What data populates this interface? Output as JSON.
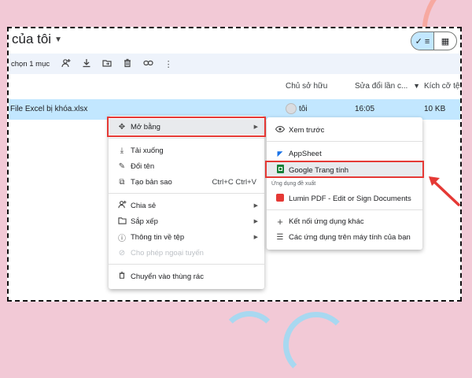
{
  "header": {
    "title": "của tôi",
    "view_list_label": "✓ ≡",
    "view_grid_label": "▦"
  },
  "toolbar": {
    "selection_text": "chọn 1 mục"
  },
  "columns": {
    "owner": "Chủ sở hữu",
    "modified": "Sửa đổi lần c...",
    "size": "Kích cỡ tệp"
  },
  "file": {
    "name": "File Excel bị khóa.xlsx",
    "owner": "tôi",
    "modified": "16:05",
    "size": "10 KB"
  },
  "context_menu": {
    "items": [
      {
        "label": "Mở bằng",
        "icon": "move-icon",
        "has_submenu": true
      },
      {
        "label": "Tải xuống",
        "icon": "download-icon"
      },
      {
        "label": "Đổi tên",
        "icon": "pencil-icon"
      },
      {
        "label": "Tạo bản sao",
        "icon": "copy-icon",
        "shortcut": "Ctrl+C Ctrl+V"
      },
      {
        "label": "Chia sẻ",
        "icon": "share-person-icon",
        "has_submenu": true
      },
      {
        "label": "Sắp xếp",
        "icon": "folder-icon",
        "has_submenu": true
      },
      {
        "label": "Thông tin về tệp",
        "icon": "info-icon",
        "has_submenu": true
      },
      {
        "label": "Cho phép ngoại tuyến",
        "icon": "offline-icon",
        "disabled": true
      },
      {
        "label": "Chuyển vào thùng rác",
        "icon": "trash-icon"
      }
    ]
  },
  "submenu": {
    "preview": "Xem trước",
    "appsheet": "AppSheet",
    "google_sheets": "Google Trang tính",
    "suggested_label": "Ứng dụng đề xuất",
    "lumin": "Lumin PDF - Edit or Sign Documents",
    "connect_more": "Kết nối ứng dụng khác",
    "computer_apps": "Các ứng dụng trên máy tính của bạn"
  },
  "colors": {
    "background": "#f2c9d6",
    "selection": "#c2e7ff",
    "highlight": "#e53935",
    "sheets_green": "#188038"
  }
}
